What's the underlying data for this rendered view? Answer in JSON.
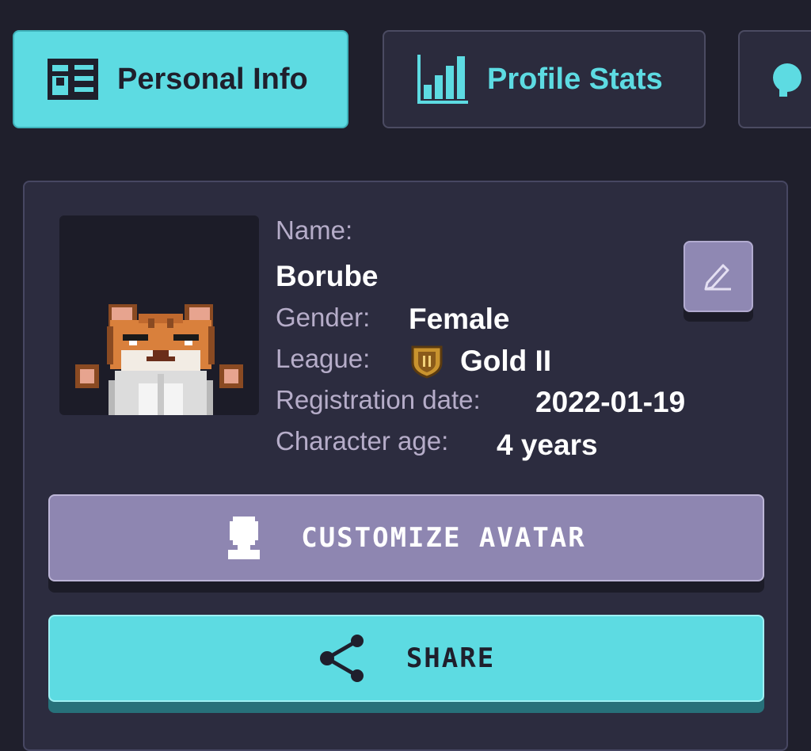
{
  "tabs": [
    {
      "label": "Personal Info",
      "icon": "id-card-icon",
      "active": true
    },
    {
      "label": "Profile Stats",
      "icon": "bar-chart-icon",
      "active": false
    },
    {
      "label": "",
      "icon": "speech-bubble-icon",
      "active": false
    }
  ],
  "profile": {
    "name_label": "Name:",
    "name_value": "Borube",
    "gender_label": "Gender:",
    "gender_value": "Female",
    "league_label": "League:",
    "league_value": "Gold II",
    "league_icon": "gold-league-shield-icon",
    "registration_label": "Registration date:",
    "registration_value": "2022-01-19",
    "age_label": "Character age:",
    "age_value": "4 years",
    "avatar_icon": "pixel-cat-avatar"
  },
  "actions": {
    "edit_icon": "pencil-icon",
    "customize_label": "CUSTOMIZE AVATAR",
    "customize_icon": "person-bust-icon",
    "share_label": "SHARE",
    "share_icon": "share-icon"
  },
  "colors": {
    "background": "#1f1f2c",
    "accent_cyan": "#5ddbe2",
    "card": "#2c2c3f",
    "purple_button": "#8e86b1",
    "label_text": "#b6adc9"
  }
}
